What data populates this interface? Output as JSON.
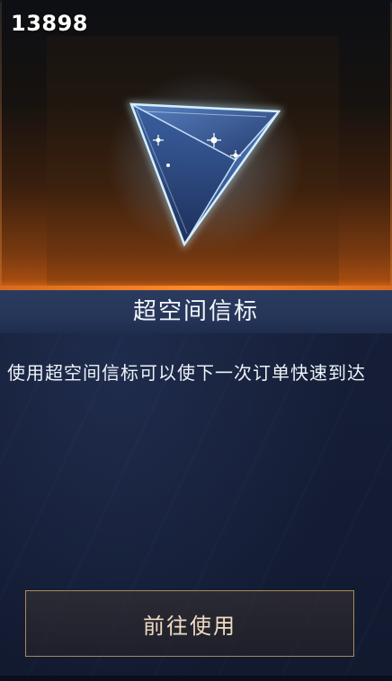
{
  "resource": {
    "count": "13898"
  },
  "item": {
    "name": "超空间信标",
    "icon": "hyperspace-beacon-crystal-icon",
    "description": "使用超空间信标可以使下一次订单快速到达"
  },
  "action": {
    "use_label": "前往使用"
  },
  "colors": {
    "accent": "#ff8a2a",
    "button_border": "#a8895a",
    "button_text": "#f0dcc0",
    "title_band": "#26365a"
  }
}
